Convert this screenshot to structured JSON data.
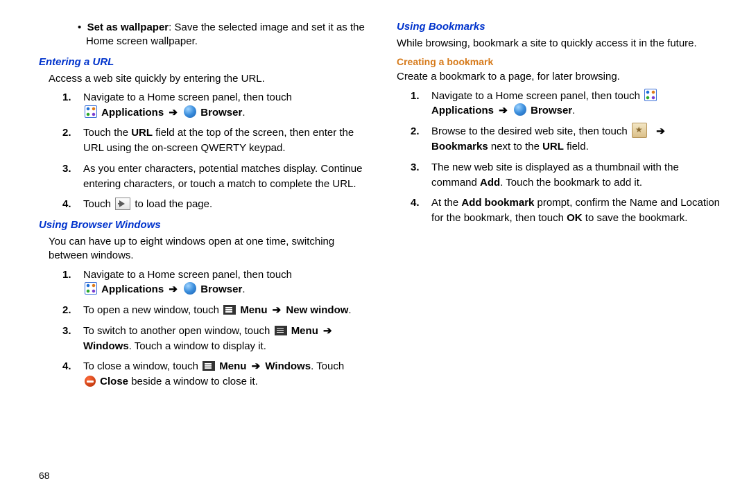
{
  "pageNumber": "68",
  "col1": {
    "bullet_label": "Set as wallpaper",
    "bullet_rest": ": Save the selected image and set it as the Home screen wallpaper.",
    "h_url": "Entering a URL",
    "url_intro": "Access a web site quickly by entering the URL.",
    "url_steps": {
      "s1a": "Navigate to a Home screen panel, then touch",
      "s1_apps": "Applications",
      "s1_arrow": "➔",
      "s1_browser": "Browser",
      "s2a": "Touch the ",
      "s2_url": "URL",
      "s2b": " field at the top of the screen, then enter the URL using the on-screen QWERTY keypad.",
      "s3": "As you enter characters, potential matches display. Continue entering characters, or touch a match to complete the URL.",
      "s4a": "Touch ",
      "s4b": " to load the page."
    },
    "h_windows": "Using Browser Windows",
    "windows_intro": "You can have up to eight windows open at one time, switching between windows.",
    "win_steps": {
      "s1a": "Navigate to a Home screen panel, then touch",
      "s1_apps": "Applications",
      "s1_arrow": "➔",
      "s1_browser": "Browser",
      "s2a": "To open a new window, touch ",
      "s2_menu": "Menu",
      "s2_arrow": "➔",
      "s2_new": "New window",
      "s3a": "To switch to another open window, touch ",
      "s3_menu": "Menu",
      "s3_arrow": "➔",
      "s3_windows": "Windows",
      "s3b": ". Touch a window to display it.",
      "s4a": "To close a window, touch ",
      "s4_menu": "Menu",
      "s4_arrow": "➔",
      "s4_windows": "Windows",
      "s4b": ". Touch ",
      "s4_close": "Close",
      "s4c": " beside a window to close it."
    }
  },
  "col2": {
    "h_bookmarks": "Using Bookmarks",
    "bookmarks_intro": "While browsing, bookmark a site to quickly access it in the future.",
    "h_creating": "Creating a bookmark",
    "create_intro": "Create a bookmark to a page, for later browsing.",
    "bm_steps": {
      "s1a": "Navigate to a Home screen panel, then touch ",
      "s1_apps": "Applications",
      "s1_arrow": "➔",
      "s1_browser": "Browser",
      "s2a": "Browse to the desired web site, then touch ",
      "s2_arrow": "➔",
      "s2_bookmarks": "Bookmarks",
      "s2b": " next to the ",
      "s2_url": "URL",
      "s2c": " field.",
      "s3a": "The new web site is displayed as a thumbnail with the command ",
      "s3_add": "Add",
      "s3b": ". Touch the bookmark to add it.",
      "s4a": "At the ",
      "s4_addbm": "Add bookmark",
      "s4b": " prompt, confirm the Name and Location for the bookmark, then touch ",
      "s4_ok": "OK",
      "s4c": " to save the bookmark."
    }
  },
  "nums": {
    "n1": "1.",
    "n2": "2.",
    "n3": "3.",
    "n4": "4."
  }
}
